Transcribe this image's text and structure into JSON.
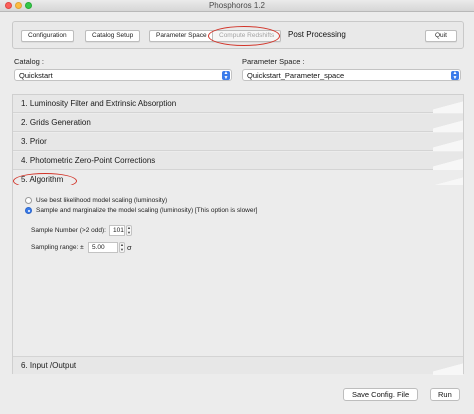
{
  "window": {
    "title": "Phosphoros 1.2"
  },
  "toolbar": {
    "configuration": "Configuration",
    "catalog_setup": "Catalog Setup",
    "parameter_space": "Parameter Space",
    "compute_redshifts": "Compute Redshifts",
    "post_processing": "Post Processing",
    "quit": "Quit"
  },
  "catalog": {
    "label": "Catalog :",
    "value": "Quickstart"
  },
  "parameter_space": {
    "label": "Parameter Space :",
    "value": "Quickstart_Parameter_space"
  },
  "sections": [
    {
      "label": "1. Luminosity Filter and Extrinsic Absorption"
    },
    {
      "label": "2. Grids Generation"
    },
    {
      "label": "3. Prior"
    },
    {
      "label": "4. Photometric Zero-Point Corrections"
    },
    {
      "label": "5. Algorithm"
    },
    {
      "label": "6. Input /Output"
    }
  ],
  "algorithm": {
    "option_best": "Use best likelihood model scaling (luminosity)",
    "option_sample": "Sample and marginalize the model scaling (luminosity) [This option is slower]",
    "sample_number_label": "Sample Number (>2 odd):",
    "sample_number_value": "101",
    "sampling_range_label": "Sampling range: ±",
    "sampling_range_value": "5.00",
    "sampling_range_unit": "σ"
  },
  "footer": {
    "save_config": "Save Config. File",
    "run": "Run"
  },
  "colors": {
    "highlight_ellipse": "#d2352a",
    "accent": "#3a7bea"
  }
}
